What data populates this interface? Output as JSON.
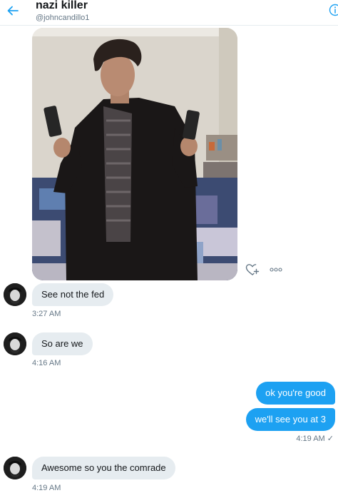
{
  "header": {
    "name": "nazi killer",
    "handle": "@johncandillo1"
  },
  "colors": {
    "accent": "#1da1f2",
    "bubble_in": "#e6ecf0",
    "muted_text": "#657786"
  },
  "icons": {
    "back": "arrow-left-icon",
    "info": "info-icon",
    "like": "heart-plus-icon",
    "more": "more-dots-icon"
  },
  "messages": [
    {
      "direction": "in",
      "text": "See not the fed",
      "time": "3:27 AM"
    },
    {
      "direction": "in",
      "text": "So are we",
      "time": "4:16 AM"
    },
    {
      "direction": "out",
      "text": "ok you're good"
    },
    {
      "direction": "out",
      "text": "we'll see you at 3",
      "time": "4:19 AM ✓"
    },
    {
      "direction": "in",
      "text": "Awesome so you the comrade",
      "time": "4:19 AM"
    }
  ]
}
